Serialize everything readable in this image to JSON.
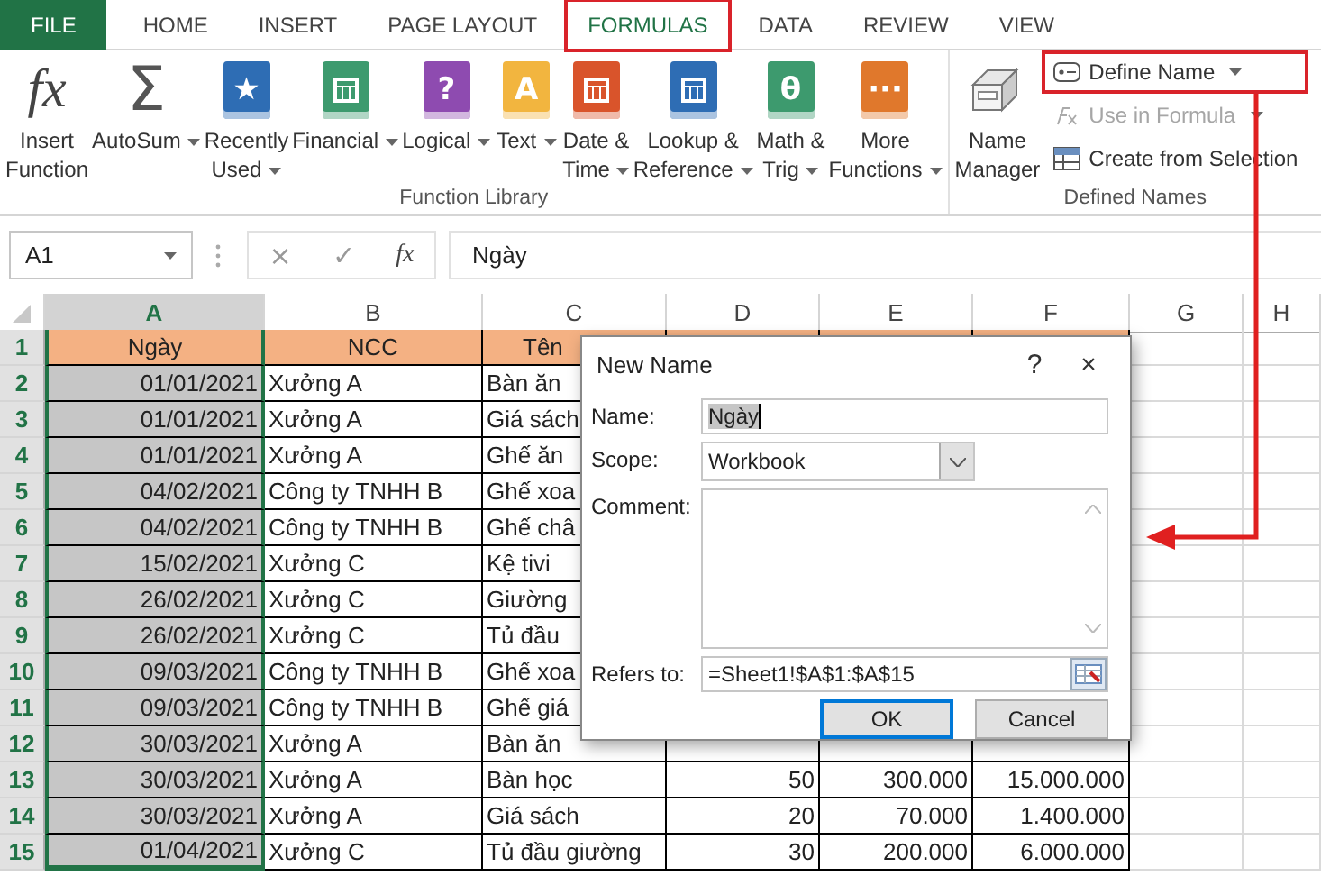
{
  "ribbon": {
    "tabs": [
      {
        "label": "FILE",
        "kind": "file",
        "selected": false,
        "highlighted": false
      },
      {
        "label": "HOME",
        "kind": "tab",
        "selected": false,
        "highlighted": false
      },
      {
        "label": "INSERT",
        "kind": "tab",
        "selected": false,
        "highlighted": false
      },
      {
        "label": "PAGE LAYOUT",
        "kind": "tab",
        "selected": false,
        "highlighted": false
      },
      {
        "label": "FORMULAS",
        "kind": "tab",
        "selected": true,
        "highlighted": true
      },
      {
        "label": "DATA",
        "kind": "tab",
        "selected": false,
        "highlighted": false
      },
      {
        "label": "REVIEW",
        "kind": "tab",
        "selected": false,
        "highlighted": false
      },
      {
        "label": "VIEW",
        "kind": "tab",
        "selected": false,
        "highlighted": false
      }
    ],
    "groups": [
      {
        "label": "Function Library",
        "buttons": [
          {
            "lines": [
              "Insert",
              "Function"
            ],
            "dropdown": false,
            "glyph": "fx"
          },
          {
            "lines": [
              "AutoSum"
            ],
            "dropdown": true,
            "glyph": "Σ"
          },
          {
            "lines": [
              "Recently",
              "Used"
            ],
            "dropdown": true,
            "color": "#2e6db4",
            "glyph": "★"
          },
          {
            "lines": [
              "Financial"
            ],
            "dropdown": true,
            "color": "#3d9a6e"
          },
          {
            "lines": [
              "Logical"
            ],
            "dropdown": true,
            "color": "#8e4bb0",
            "glyph": "?"
          },
          {
            "lines": [
              "Text"
            ],
            "dropdown": true,
            "color": "#f2b53f",
            "glyph": "A"
          },
          {
            "lines": [
              "Date &",
              "Time"
            ],
            "dropdown": true,
            "color": "#d9542b"
          },
          {
            "lines": [
              "Lookup &",
              "Reference"
            ],
            "dropdown": true,
            "color": "#2e6db4"
          },
          {
            "lines": [
              "Math &",
              "Trig"
            ],
            "dropdown": true,
            "color": "#3d9a6e",
            "glyph": "θ"
          },
          {
            "lines": [
              "More",
              "Functions"
            ],
            "dropdown": true,
            "color": "#e0782c",
            "glyph": "···"
          }
        ]
      },
      {
        "label": "Defined Names",
        "buttons": [
          {
            "lines": [
              "Name",
              "Manager"
            ],
            "dropdown": false
          }
        ],
        "small_buttons": [
          {
            "label": "Define Name",
            "dropdown": true,
            "disabled": false,
            "highlighted": true
          },
          {
            "label": "Use in Formula",
            "dropdown": true,
            "disabled": true,
            "highlighted": false
          },
          {
            "label": "Create from Selection",
            "dropdown": false,
            "disabled": false,
            "highlighted": false
          }
        ]
      }
    ]
  },
  "formula_bar": {
    "name_box": "A1",
    "cancel_glyph": "×",
    "enter_glyph": "✓",
    "function_glyph": "fx",
    "value": "Ngày"
  },
  "sheet": {
    "columns": [
      {
        "label": "A",
        "selected": true
      },
      {
        "label": "B",
        "selected": false
      },
      {
        "label": "C",
        "selected": false
      },
      {
        "label": "D",
        "selected": false
      },
      {
        "label": "E",
        "selected": false
      },
      {
        "label": "F",
        "selected": false
      },
      {
        "label": "G",
        "selected": false
      },
      {
        "label": "H",
        "selected": false
      }
    ],
    "rows": [
      {
        "number": "1",
        "kind": "header",
        "cells": [
          "Ngày",
          "NCC",
          "Tên"
        ]
      },
      {
        "number": "2",
        "kind": "data",
        "cells": [
          "01/01/2021",
          "Xưởng A",
          "Bàn ăn"
        ]
      },
      {
        "number": "3",
        "kind": "data",
        "cells": [
          "01/01/2021",
          "Xưởng A",
          "Giá sách"
        ]
      },
      {
        "number": "4",
        "kind": "data",
        "cells": [
          "01/01/2021",
          "Xưởng A",
          "Ghế ăn"
        ]
      },
      {
        "number": "5",
        "kind": "data",
        "cells": [
          "04/02/2021",
          "Công ty TNHH B",
          "Ghế xoa"
        ]
      },
      {
        "number": "6",
        "kind": "data",
        "cells": [
          "04/02/2021",
          "Công ty TNHH B",
          "Ghế châ"
        ]
      },
      {
        "number": "7",
        "kind": "data",
        "cells": [
          "15/02/2021",
          "Xưởng C",
          "Kệ tivi"
        ]
      },
      {
        "number": "8",
        "kind": "data",
        "cells": [
          "26/02/2021",
          "Xưởng C",
          "Giường"
        ]
      },
      {
        "number": "9",
        "kind": "data",
        "cells": [
          "26/02/2021",
          "Xưởng C",
          "Tủ đầu"
        ]
      },
      {
        "number": "10",
        "kind": "data",
        "cells": [
          "09/03/2021",
          "Công ty TNHH B",
          "Ghế xoa"
        ]
      },
      {
        "number": "11",
        "kind": "data",
        "cells": [
          "09/03/2021",
          "Công ty TNHH B",
          "Ghế giá"
        ]
      },
      {
        "number": "12",
        "kind": "data",
        "cells": [
          "30/03/2021",
          "Xưởng A",
          "Bàn ăn"
        ]
      },
      {
        "number": "13",
        "kind": "data",
        "cells": [
          "30/03/2021",
          "Xưởng A",
          "Bàn học",
          "50",
          "300.000",
          "15.000.000"
        ]
      },
      {
        "number": "14",
        "kind": "data",
        "cells": [
          "30/03/2021",
          "Xưởng A",
          "Giá sách",
          "20",
          "70.000",
          "1.400.000"
        ]
      },
      {
        "number": "15",
        "kind": "data",
        "cells": [
          "01/04/2021",
          "Xưởng C",
          "Tủ đầu giường",
          "30",
          "200.000",
          "6.000.000"
        ]
      }
    ]
  },
  "dialog": {
    "title": "New Name",
    "help": "?",
    "close": "×",
    "name_label": "Name:",
    "name_value": "Ngày",
    "scope_label": "Scope:",
    "scope_value": "Workbook",
    "comment_label": "Comment:",
    "refers_label": "Refers to:",
    "refers_value": "=Sheet1!$A$1:$A$15",
    "buttons": [
      {
        "label": "OK",
        "focused": true
      },
      {
        "label": "Cancel",
        "focused": false
      }
    ]
  }
}
